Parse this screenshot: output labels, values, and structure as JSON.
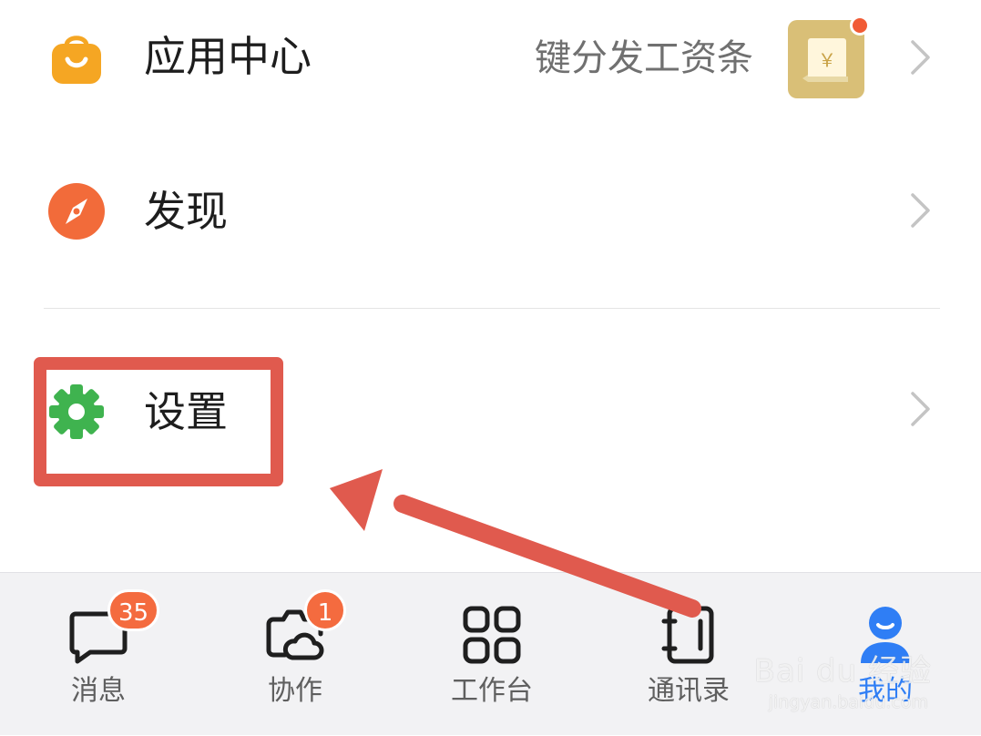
{
  "menu": {
    "app_center": {
      "label": "应用中心",
      "subtitle": "键分发工资条",
      "badge_symbol": "￥",
      "icon": "shopping-bag-icon",
      "icon_color": "#f5a623"
    },
    "discover": {
      "label": "发现",
      "icon": "compass-icon",
      "icon_color": "#f26b3a"
    },
    "settings": {
      "label": "设置",
      "icon": "gear-icon",
      "icon_color": "#3fb34f"
    }
  },
  "annotation": {
    "highlight_color": "#e05a4e"
  },
  "tabbar": {
    "tabs": [
      {
        "label": "消息",
        "icon": "chat-bubble-icon",
        "badge": "35"
      },
      {
        "label": "协作",
        "icon": "camera-cloud-icon",
        "badge": "1"
      },
      {
        "label": "工作台",
        "icon": "grid-icon"
      },
      {
        "label": "通讯录",
        "icon": "contacts-book-icon"
      },
      {
        "label": "我的",
        "icon": "person-icon",
        "active": true
      }
    ],
    "active_color": "#2f7ef5",
    "badge_color": "#f46b3f"
  },
  "watermark": {
    "brand": "Bai du 经验",
    "url": "jingyan.baidu.com"
  }
}
